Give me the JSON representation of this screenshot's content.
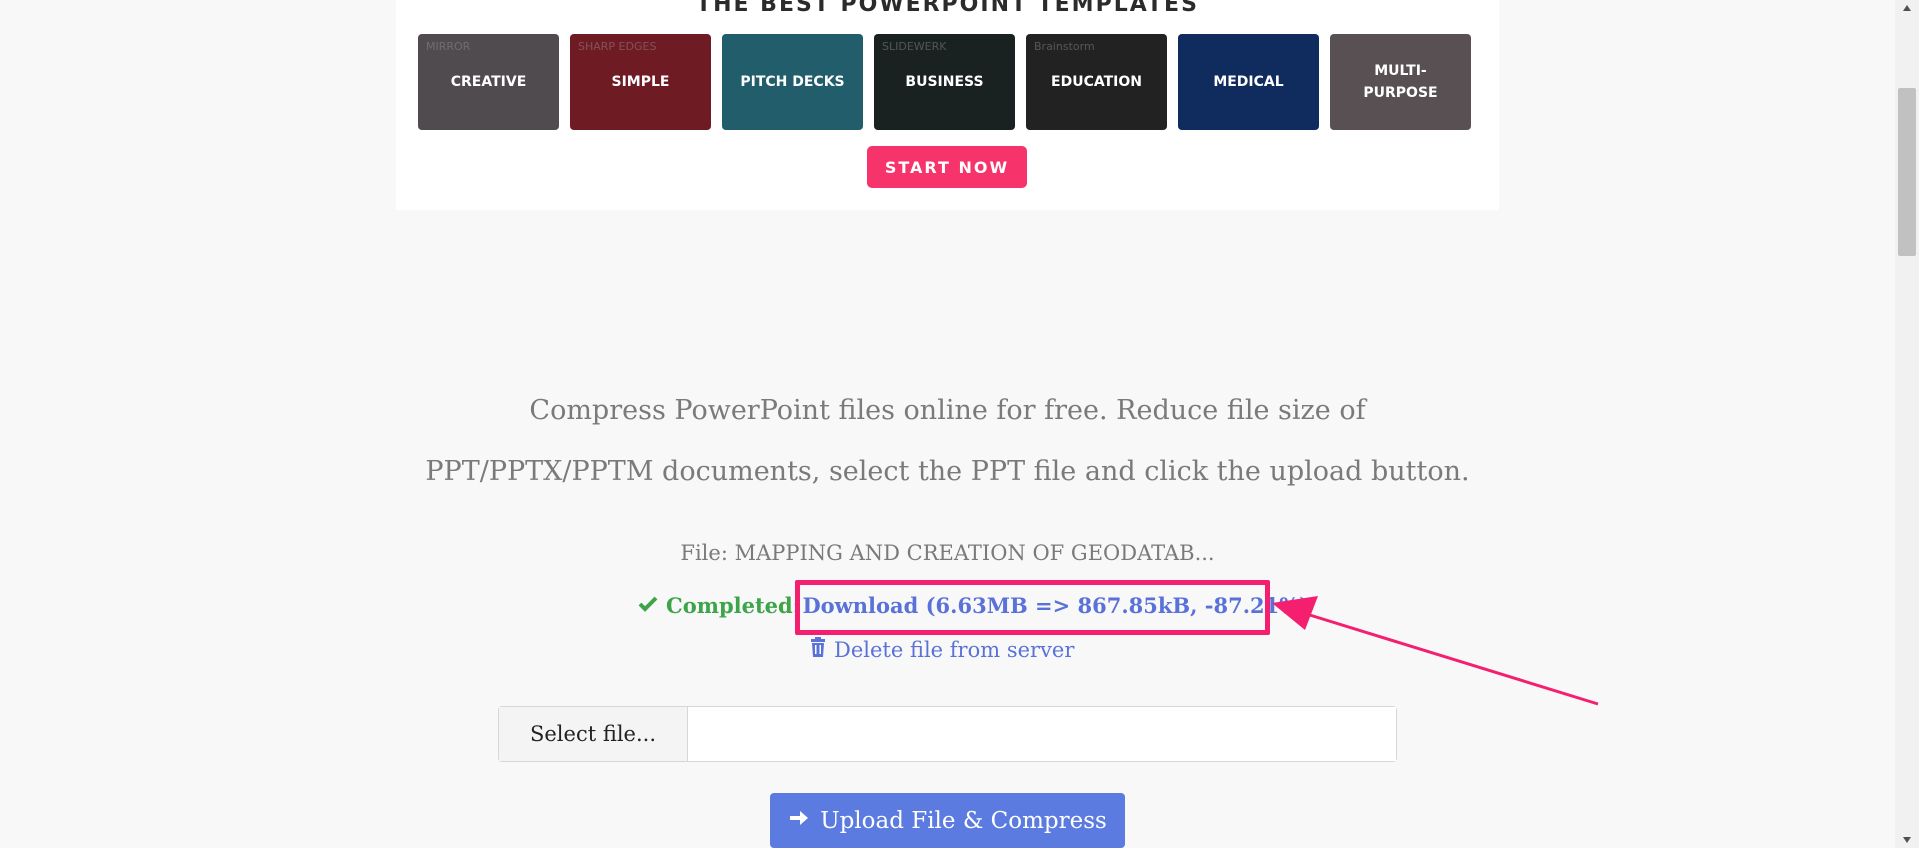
{
  "banner": {
    "title": "THE BEST POWERPOINT TEMPLATES",
    "start_label": "START NOW",
    "tiles": [
      {
        "label": "CREATIVE",
        "deco": "MIRROR",
        "bg": "#8a8287"
      },
      {
        "label": "SIMPLE",
        "deco": "SHARP EDGES",
        "bg": "#c0303f"
      },
      {
        "label": "PITCH DECKS",
        "deco": "",
        "bg": "#3aa0b8"
      },
      {
        "label": "BUSINESS",
        "deco": "SLIDEWERK",
        "bg": "#2e3a3a"
      },
      {
        "label": "EDUCATION",
        "deco": "Brainstorm",
        "bg": "#3b3b3b"
      },
      {
        "label": "MEDICAL",
        "deco": "",
        "bg": "#1d4aa0"
      },
      {
        "label": "MULTI-PURPOSE",
        "deco": "",
        "bg": "#9a8a90"
      }
    ]
  },
  "main": {
    "intro_line1": "Compress PowerPoint files online for free. Reduce file size of",
    "intro_line2": "PPT/PPTX/PPTM documents, select the PPT file and click the upload button.",
    "file_label": "File: MAPPING AND CREATION OF GEODATAB...",
    "completed_label": "Completed:",
    "download_label": "Download (6.63MB => 867.85kB, -87.21%)",
    "delete_label": "Delete file from server",
    "select_label": "Select file...",
    "file_value": "",
    "upload_label": "Upload File & Compress"
  },
  "colors": {
    "accent": "#f6336b",
    "highlight": "#f41f6e",
    "link": "#5a72d8",
    "success": "#3ea44a",
    "upload_button": "#5b7be0"
  },
  "icons": {
    "check": "check-icon",
    "trash": "trash-icon",
    "arrow": "arrow-right-icon"
  }
}
